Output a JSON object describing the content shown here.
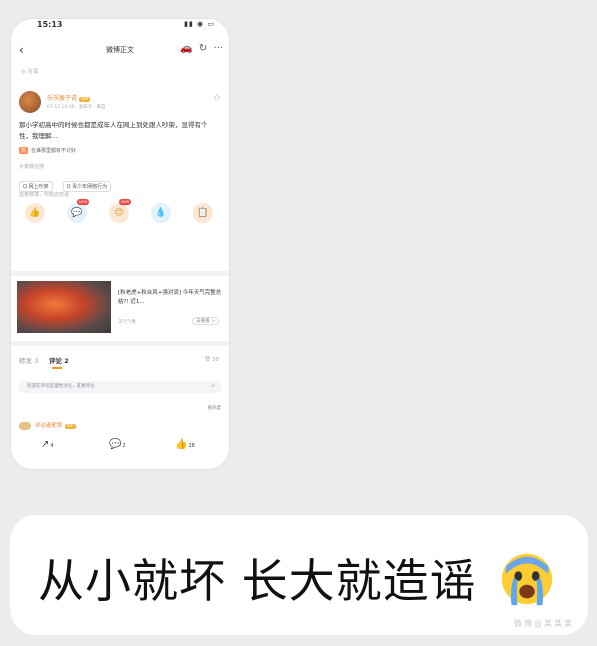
{
  "status": {
    "time": "15:13",
    "icons": "▮▮ ◉ ▭"
  },
  "nav": {
    "back": "‹",
    "title": "微博正文",
    "actions": [
      "🚗",
      "↻",
      "···"
    ]
  },
  "share_tag": "◎ 分享",
  "post": {
    "username": "乐乐猴子说",
    "vip": "VIP",
    "meta": "07-12 19:36 · 发布于 · 来自",
    "content": "那小学初高中的时候也都是成年人在网上到处跟人吵架，显得有个性，我理解...",
    "topic_hot": "热",
    "topic": "在谁那里都有不讨好",
    "related_label": "大家都在搜",
    "chips": [
      "Q 网上吵架",
      "Q 青少年网络行为"
    ],
    "react_label": "这条微博，你想这样说",
    "reactions": [
      "👍",
      "💬",
      "😊",
      "💧",
      "📋"
    ]
  },
  "news": {
    "title": "[秋老虎+秋台风+强对流] 今年天气完整总结?! 近1...",
    "source": "天气气象",
    "button": "去看看 >"
  },
  "tabs": {
    "repost": "转发 3",
    "comment": "评论 2",
    "like": "赞 30"
  },
  "notice": {
    "text": "欢迎在评论区理性讨论，友善评论",
    "close": "×"
  },
  "sort": "按热度",
  "commenter": {
    "name": "评论者昵称",
    "vip": "VIP"
  },
  "bottom": {
    "share": "↗",
    "share_count": "4",
    "comment": "💬",
    "comment_count": "2",
    "like": "👍",
    "like_count": "28"
  },
  "caption": "从小就坏 长大就造谣",
  "emoji": "crying-face-emoji",
  "watermark": "微博@某某某"
}
